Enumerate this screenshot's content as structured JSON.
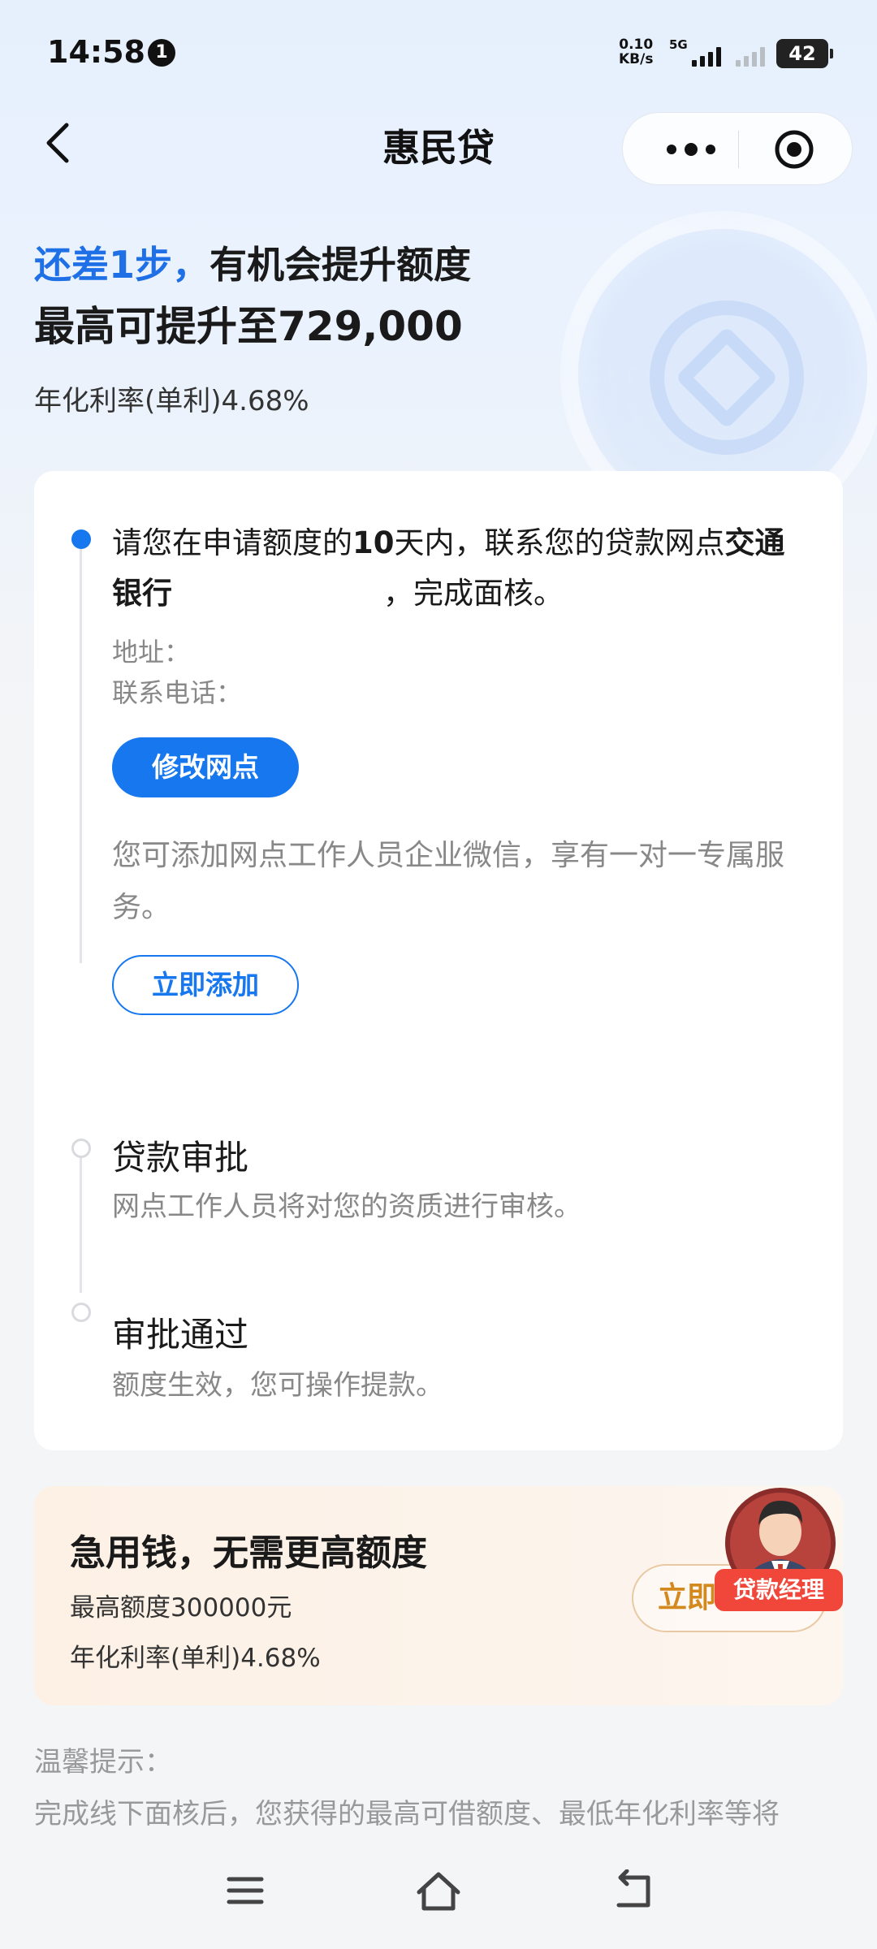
{
  "status_bar": {
    "time": "14:58",
    "notification_count": "1",
    "net_speed_value": "0.10",
    "net_speed_unit": "KB/s",
    "network": "5G",
    "battery": "42"
  },
  "nav": {
    "title": "惠民贷"
  },
  "hero": {
    "line1_accent": "还差1步，",
    "line1_rest": "有机会提升额度",
    "line2": "最高可提升至729,000",
    "rate": "年化利率(单利)4.68%"
  },
  "steps": {
    "step1": {
      "text_part1": "请您在申请额度的",
      "text_bold1": "10",
      "text_part2": "天内，联系您的贷款网点",
      "text_bold2": "交通银行",
      "text_part3": "，完成面核。",
      "address_label": "地址：",
      "phone_label": "联系电话：",
      "change_branch_button": "修改网点",
      "wechat_tip": "您可添加网点工作人员企业微信，享有一对一专属服务。",
      "add_now_button": "立即添加"
    },
    "step2": {
      "title": "贷款审批",
      "desc": "网点工作人员将对您的资质进行审核。"
    },
    "step3": {
      "title": "审批通过",
      "desc": "额度生效，您可操作提款。"
    }
  },
  "promo": {
    "title": "急用钱，无需更高额度",
    "limit": "最高额度300000元",
    "rate": "年化利率(单利)4.68%",
    "button": "立即",
    "manager_badge": "贷款经理"
  },
  "tips": {
    "title": "温馨提示：",
    "body": "完成线下面核后，您获得的最高可借额度、最低年化利率等将"
  },
  "colors": {
    "accent": "#1677ee",
    "promo_button": "#d4891f",
    "badge": "#f0473a"
  },
  "icons": {
    "back": "chevron-left-icon",
    "more": "more-dots-icon",
    "close_miniprogram": "target-circle-icon",
    "menu": "menu-lines-icon",
    "home": "home-icon",
    "return": "return-arrow-icon"
  }
}
